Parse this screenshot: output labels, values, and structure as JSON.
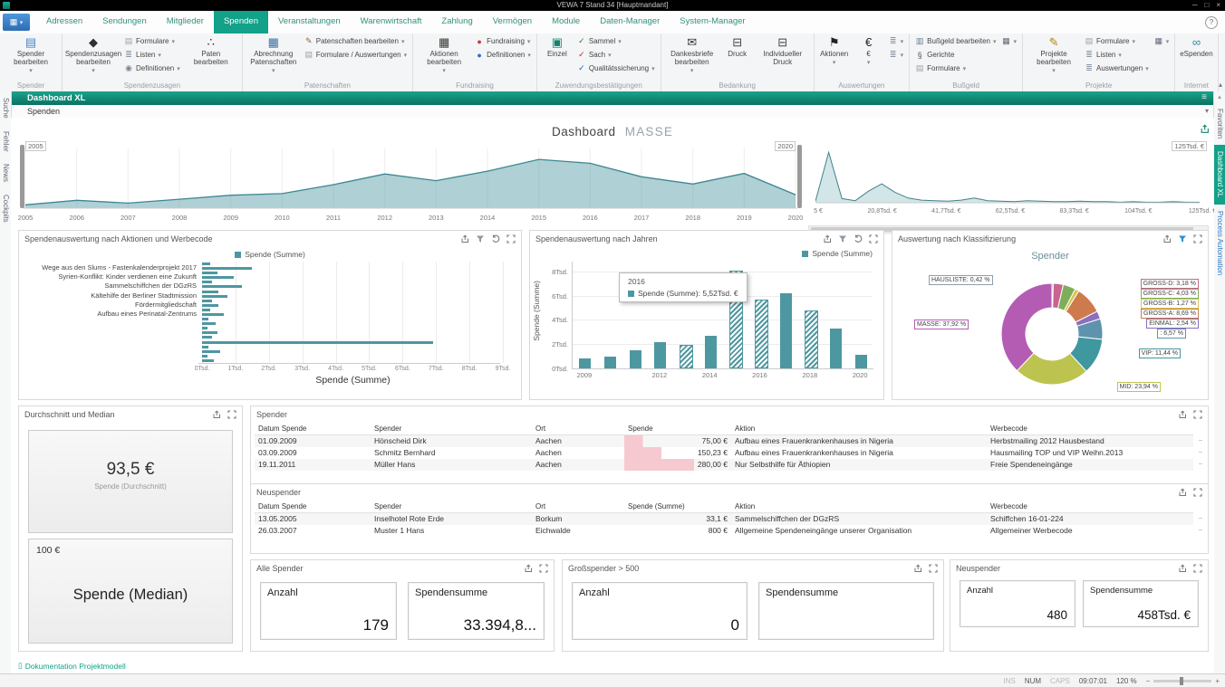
{
  "window": {
    "title": "VEWA 7 Stand 34 [Hauptmandant]"
  },
  "menu": {
    "tabs": [
      {
        "label": "Adressen",
        "active": false
      },
      {
        "label": "Sendungen",
        "active": false
      },
      {
        "label": "Mitglieder",
        "active": false
      },
      {
        "label": "Spenden",
        "active": true
      },
      {
        "label": "Veranstaltungen",
        "active": false
      },
      {
        "label": "Warenwirtschaft",
        "active": false
      },
      {
        "label": "Zahlung",
        "active": false
      },
      {
        "label": "Vermögen",
        "active": false
      },
      {
        "label": "Module",
        "active": false
      },
      {
        "label": "Daten-Manager",
        "active": false
      },
      {
        "label": "System-Manager",
        "active": false
      }
    ],
    "help": "?"
  },
  "ribbon": {
    "groups": [
      {
        "label": "Spender",
        "items": [
          {
            "type": "big",
            "label": "Spender bearbeiten",
            "dropdown": true,
            "icon": "spender-icon"
          }
        ]
      },
      {
        "label": "Spendenzusagen",
        "items": [
          {
            "type": "big",
            "label": "Spendenzusagen bearbeiten",
            "dropdown": true,
            "icon": "spendenzusagen-icon"
          },
          {
            "type": "small",
            "label": "Formulare",
            "dropdown": true,
            "icon": "formulare-icon"
          },
          {
            "type": "small",
            "label": "Listen",
            "dropdown": true,
            "icon": "listen-icon"
          },
          {
            "type": "small",
            "label": "Definitionen",
            "dropdown": true,
            "icon": "definitionen-icon"
          },
          {
            "type": "big",
            "label": "Paten bearbeiten",
            "dropdown": false,
            "icon": "paten-icon"
          }
        ]
      },
      {
        "label": "Patenschaften",
        "items": [
          {
            "type": "big",
            "label": "Abrechnung Patenschaften",
            "dropdown": true,
            "icon": "abrechnung-icon"
          },
          {
            "type": "small",
            "label": "Patenschaften bearbeiten",
            "dropdown": true,
            "icon": "patenschaften-icon"
          },
          {
            "type": "small",
            "label": "Formulare / Auswertungen",
            "dropdown": true,
            "icon": "formulare-icon"
          }
        ]
      },
      {
        "label": "Fundraising",
        "items": [
          {
            "type": "big",
            "label": "Aktionen bearbeiten",
            "dropdown": true,
            "icon": "aktionen-grid-icon"
          },
          {
            "type": "small",
            "label": "Fundraising",
            "dropdown": true,
            "icon": "fundraising-icon"
          },
          {
            "type": "small",
            "label": "Definitionen",
            "dropdown": true,
            "icon": "definitionen-blue-icon"
          }
        ]
      },
      {
        "label": "Zuwendungsbestätigungen",
        "items": [
          {
            "type": "big",
            "label": "Einzel",
            "dropdown": false,
            "icon": "einzel-icon"
          },
          {
            "type": "small",
            "label": "Sammel",
            "dropdown": true,
            "icon": "sammel-icon"
          },
          {
            "type": "small",
            "label": "Sach",
            "dropdown": true,
            "icon": "sach-icon"
          },
          {
            "type": "small",
            "label": "Qualitätssicherung",
            "dropdown": true,
            "icon": "qualitaet-icon"
          }
        ]
      },
      {
        "label": "Bedankung",
        "items": [
          {
            "type": "big",
            "label": "Dankesbriefe bearbeiten",
            "dropdown": true,
            "icon": "dankesbriefe-icon"
          },
          {
            "type": "big",
            "label": "Druck",
            "dropdown": false,
            "icon": "druck-icon"
          },
          {
            "type": "big",
            "label": "Individueller Druck",
            "dropdown": false,
            "icon": "druck-icon"
          }
        ]
      },
      {
        "label": "Auswertungen",
        "items": [
          {
            "type": "big",
            "label": "Aktionen",
            "dropdown": true,
            "icon": "tag-icon"
          },
          {
            "type": "big",
            "label": "€",
            "dropdown": true,
            "icon": "euro-icon"
          },
          {
            "type": "small",
            "label": "",
            "dropdown": true,
            "icon": "listen-icon"
          },
          {
            "type": "small",
            "label": "",
            "dropdown": true,
            "icon": "listen-icon"
          }
        ]
      },
      {
        "label": "Bußgeld",
        "items": [
          {
            "type": "small",
            "label": "Bußgeld bearbeiten",
            "dropdown": true,
            "icon": "bussgeld-icon"
          },
          {
            "type": "small",
            "label": "Gerichte",
            "dropdown": false,
            "icon": "gerichte-icon"
          },
          {
            "type": "small",
            "label": "Formulare",
            "dropdown": true,
            "icon": "formulare-icon"
          },
          {
            "type": "small",
            "label": "",
            "dropdown": true,
            "icon": "grid-icon"
          }
        ]
      },
      {
        "label": "Projekte",
        "items": [
          {
            "type": "big",
            "label": "Projekte bearbeiten",
            "dropdown": true,
            "icon": "projekte-icon"
          },
          {
            "type": "small",
            "label": "Formulare",
            "dropdown": true,
            "icon": "formulare-icon"
          },
          {
            "type": "small",
            "label": "Listen",
            "dropdown": true,
            "icon": "listen-icon"
          },
          {
            "type": "small",
            "label": "Auswertungen",
            "dropdown": true,
            "icon": "auswertungen-icon"
          },
          {
            "type": "small",
            "label": "",
            "dropdown": true,
            "icon": "grid-icon"
          }
        ]
      },
      {
        "label": "Internet",
        "items": [
          {
            "type": "big",
            "label": "eSpenden",
            "dropdown": false,
            "icon": "espenden-icon"
          }
        ]
      }
    ]
  },
  "rails": {
    "left": [
      {
        "label": "Suche"
      },
      {
        "label": "Fehler"
      },
      {
        "label": "News"
      },
      {
        "label": "Cockpits"
      }
    ],
    "right": [
      {
        "label": "Favoriten",
        "active": false,
        "blue": false
      },
      {
        "label": "Dashboard XL",
        "active": true,
        "blue": false
      },
      {
        "label": "Process Automation",
        "active": false,
        "blue": true
      }
    ]
  },
  "bars": {
    "dashboard_title": "Dashboard XL",
    "sub_title": "Spenden"
  },
  "page": {
    "title_main": "Dashboard",
    "title_sub": "MASSE"
  },
  "panels": {
    "aktionen": {
      "title": "Spendenauswertung nach Aktionen und Werbecode",
      "icons": [
        "export-icon",
        "filter-icon",
        "undo-icon",
        "expand-icon"
      ]
    },
    "jahre": {
      "title": "Spendenauswertung nach Jahren",
      "icons": [
        "export-icon",
        "filter-icon",
        "undo-icon",
        "expand-icon"
      ]
    },
    "klass": {
      "title": "Auswertung nach Klassifizierung",
      "icons": [
        "export-icon",
        "filter-active-icon",
        "expand-icon"
      ]
    },
    "durchschnitt": {
      "title": "Durchschnitt und Median",
      "icons": [
        "export-icon",
        "expand-icon"
      ],
      "avg_value": "93,5 €",
      "avg_label": "Spende (Durchschnitt)",
      "median_value": "100 €",
      "median_label": "Spende (Median)"
    },
    "spender_table": {
      "title": "Spender",
      "icons": [
        "export-icon",
        "expand-icon"
      ]
    },
    "neuspender_table": {
      "title": "Neuspender",
      "icons": [
        "export-icon",
        "expand-icon"
      ]
    },
    "alle_spender": {
      "title": "Alle Spender",
      "icons": [
        "export-icon",
        "expand-icon"
      ],
      "cards": [
        {
          "label": "Anzahl",
          "value": "179"
        },
        {
          "label": "Spendensumme",
          "value": "33.394,8..."
        }
      ]
    },
    "grossspender": {
      "title": "Großspender > 500",
      "icons": [
        "export-icon",
        "expand-icon"
      ],
      "cards": [
        {
          "label": "Anzahl",
          "value": "0"
        },
        {
          "label": "Spendensumme",
          "value": ""
        }
      ]
    },
    "neuspender_stats": {
      "title": "Neuspender",
      "icons": [
        "export-icon",
        "expand-icon"
      ],
      "cards": [
        {
          "label": "Anzahl",
          "value": "480"
        },
        {
          "label": "Spendensumme",
          "value": "458Tsd. €"
        }
      ]
    }
  },
  "chart_data": [
    {
      "id": "spenden-timeline",
      "type": "area",
      "x": [
        "2005",
        "2006",
        "2007",
        "2008",
        "2009",
        "2010",
        "2011",
        "2012",
        "2013",
        "2014",
        "2015",
        "2016",
        "2017",
        "2018",
        "2019",
        "2020"
      ],
      "values": [
        0.6,
        1.4,
        0.9,
        1.6,
        2.3,
        2.6,
        4.2,
        6.1,
        4.9,
        6.6,
        8.7,
        8.0,
        5.6,
        4.3,
        6.2,
        2.4
      ],
      "ylim": [
        0,
        10
      ],
      "range_start": "2005",
      "range_end": "2020"
    },
    {
      "id": "spenden-verteilung",
      "type": "line",
      "x_ticks": [
        "5 €",
        "20,8Tsd. €",
        "41,7Tsd. €",
        "62,5Tsd. €",
        "83,3Tsd. €",
        "104Tsd. €",
        "125Tsd. €"
      ],
      "max_label": "125Tsd. €",
      "values": [
        0.3,
        9.6,
        0.8,
        0.4,
        2.2,
        3.6,
        2.0,
        0.9,
        0.5,
        0.4,
        0.3,
        0.5,
        0.9,
        0.4,
        0.3,
        0.2,
        0.4,
        0.3,
        0.2,
        0.2,
        0.3,
        0.2,
        0.2,
        0.1,
        0.2,
        0.1,
        0.1,
        0.2,
        0.1,
        0.1
      ],
      "ylim": [
        0,
        10
      ]
    },
    {
      "id": "aktionen-werbecode",
      "type": "bar",
      "orientation": "horizontal",
      "series_name": "Spende (Summe)",
      "xlabel": "Spende (Summe)",
      "x_ticks": [
        "0Tsd.",
        "1Tsd.",
        "2Tsd.",
        "3Tsd.",
        "4Tsd.",
        "5Tsd.",
        "6Tsd.",
        "7Tsd.",
        "8Tsd.",
        "9Tsd."
      ],
      "xlim": [
        0,
        9
      ],
      "categories": [
        "Wege aus den Slums - Fastenkalenderprojekt 2017",
        "Syrien-Konflikt: Kinder verdienen eine Zukunft",
        "Sammelschiffchen der DGzRS",
        "Kältehilfe der Berliner Stadtmission",
        "Fördermitgliedschaft",
        "Aufbau eines Perinatal-Zentrums"
      ],
      "category_rows": [
        1,
        3,
        5,
        7,
        9,
        11
      ],
      "values": [
        0.25,
        1.5,
        0.45,
        0.95,
        0.3,
        1.2,
        0.5,
        0.75,
        0.3,
        0.5,
        0.25,
        0.65,
        0.2,
        0.4,
        0.15,
        0.45,
        0.3,
        6.9,
        0.2,
        0.55,
        0.15,
        0.35
      ]
    },
    {
      "id": "spenden-jahre",
      "type": "bar",
      "series_name": "Spende (Summe)",
      "ylabel": "Spende (Summe)",
      "categories": [
        "2009",
        "2010",
        "2011",
        "2012",
        "2013",
        "2014",
        "2015",
        "2016",
        "2017",
        "2018",
        "2019",
        "2020"
      ],
      "values": [
        0.8,
        1.0,
        1.5,
        2.2,
        1.8,
        2.7,
        7.9,
        5.52,
        6.2,
        4.6,
        3.3,
        1.1
      ],
      "hatched_indices": [
        4,
        6,
        7,
        9
      ],
      "y_ticks": [
        "0Tsd.",
        "2Tsd.",
        "4Tsd.",
        "6Tsd.",
        "8Tsd."
      ],
      "y_tick_values": [
        0,
        2,
        4,
        6,
        8
      ],
      "ylim": [
        0,
        8.8
      ],
      "x_tick_indices": [
        0,
        3,
        5,
        7,
        9,
        11
      ],
      "tooltip": {
        "title": "2016",
        "text": "Spende (Summe): 5,52Tsd. €"
      }
    },
    {
      "id": "klassifizierung",
      "type": "pie",
      "title": "Spender",
      "slices": [
        {
          "label": "HAUSLISTE",
          "pct": 0.42,
          "display": "HAUSLISTE: 0,42 %",
          "color": "#8ca0a8"
        },
        {
          "label": "GROSS-D",
          "pct": 3.18,
          "display": "GROSS-D: 3,18 %",
          "color": "#c9648f"
        },
        {
          "label": "GROSS-C",
          "pct": 4.03,
          "display": "GROSS-C: 4,03 %",
          "color": "#7fae5a"
        },
        {
          "label": "GROSS-B",
          "pct": 1.27,
          "display": "GROSS-B: 1,27 %",
          "color": "#d8c44e"
        },
        {
          "label": "GROSS-A",
          "pct": 8.69,
          "display": "GROSS-A: 8,69 %",
          "color": "#cd7a4d"
        },
        {
          "label": "EINMAL",
          "pct": 2.54,
          "display": "EINMAL: 2,54 %",
          "color": "#8a6fc0"
        },
        {
          "label": "",
          "pct": 6.57,
          "display": ": 6,57 %",
          "color": "#5f93ad"
        },
        {
          "label": "VIP",
          "pct": 11.44,
          "display": "VIP: 11,44 %",
          "color": "#3f97a0"
        },
        {
          "label": "MID",
          "pct": 23.94,
          "display": "MID: 23,94 %",
          "color": "#bcc44f"
        },
        {
          "label": "MASSE",
          "pct": 37.92,
          "display": "MASSE: 37,92 %",
          "color": "#b45cb4"
        }
      ]
    }
  ],
  "tables": {
    "spender": {
      "columns": [
        "Datum Spende",
        "Spender",
        "Ort",
        "Spende",
        "Aktion",
        "Werbecode"
      ],
      "rows": [
        {
          "cells": [
            "01.09.2009",
            "Hönscheid Dirk",
            "Aachen",
            "75,00 €",
            "Aufbau eines Frauenkrankenhauses in Nigeria",
            "Herbstmailing 2012 Hausbestand"
          ],
          "amount": 75
        },
        {
          "cells": [
            "03.09.2009",
            "Schmitz Bernhard",
            "Aachen",
            "150,23 €",
            "Aufbau eines Frauenkrankenhauses in Nigeria",
            "Hausmailing TOP und VIP Weihn.2013"
          ],
          "amount": 150.23
        },
        {
          "cells": [
            "19.11.2011",
            "Müller Hans",
            "Aachen",
            "280,00 €",
            "Nur Selbsthilfe für Äthiopien",
            "Freie Spendeneingänge"
          ],
          "amount": 280
        }
      ]
    },
    "neuspender": {
      "columns": [
        "Datum Spende",
        "Spender",
        "Ort",
        "Spende (Summe)",
        "Aktion",
        "Werbecode"
      ],
      "rows": [
        {
          "cells": [
            "13.05.2005",
            "Inselhotel Rote Erde",
            "Borkum",
            "33,1 €",
            "Sammelschiffchen der DGzRS",
            "Schiffchen 16-01-224"
          ],
          "amount": null
        },
        {
          "cells": [
            "26.03.2007",
            "Muster 1 Hans",
            "Eichwalde",
            "800 €",
            "Allgemeine Spendeneingänge unserer Organisation",
            "Allgemeiner Werbecode"
          ],
          "amount": null
        }
      ]
    }
  },
  "footer": {
    "link": "Dokumentation Projektmodell"
  },
  "statusbar": {
    "ins": "INS",
    "num": "NUM",
    "caps": "CAPS",
    "time": "09:07:01",
    "zoom": "120 %"
  },
  "colors": {
    "accent": "#12a189",
    "chart": "#4d97a1",
    "bar_pink": "#f6c9d0"
  }
}
